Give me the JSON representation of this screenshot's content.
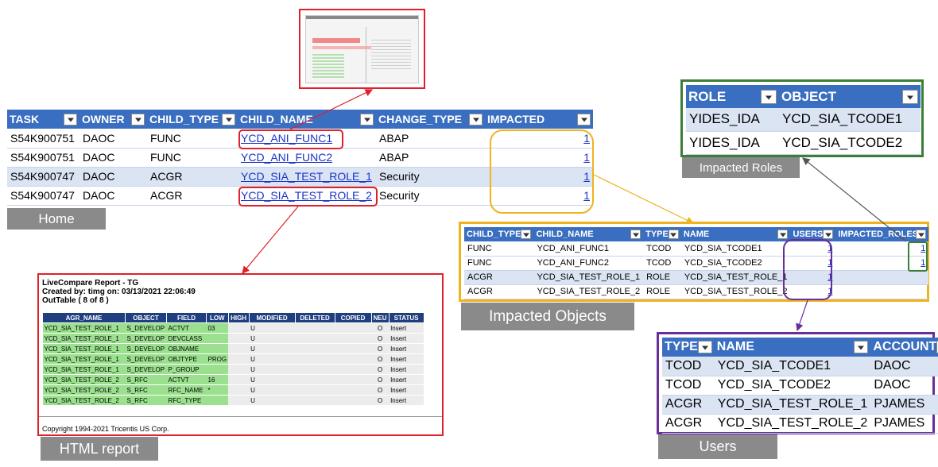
{
  "home": {
    "caption": "Home",
    "headers": [
      "TASK",
      "OWNER",
      "CHILD_TYPE",
      "CHILD_NAME",
      "CHANGE_TYPE",
      "IMPACTED"
    ],
    "rows": [
      {
        "task": "S54K900751",
        "owner": "DAOC",
        "child_type": "FUNC",
        "child_name": "YCD_ANI_FUNC1",
        "change_type": "ABAP",
        "impacted": "1"
      },
      {
        "task": "S54K900751",
        "owner": "DAOC",
        "child_type": "FUNC",
        "child_name": "YCD_ANI_FUNC2",
        "change_type": "ABAP",
        "impacted": "1"
      },
      {
        "task": "S54K900747",
        "owner": "DAOC",
        "child_type": "ACGR",
        "child_name": "YCD_SIA_TEST_ROLE_1",
        "change_type": "Security",
        "impacted": "1"
      },
      {
        "task": "S54K900747",
        "owner": "DAOC",
        "child_type": "ACGR",
        "child_name": "YCD_SIA_TEST_ROLE_2",
        "change_type": "Security",
        "impacted": "1"
      }
    ]
  },
  "impacted_roles": {
    "caption": "Impacted Roles",
    "headers": [
      "ROLE",
      "OBJECT"
    ],
    "rows": [
      {
        "role": "YIDES_IDA",
        "object": "YCD_SIA_TCODE1"
      },
      {
        "role": "YIDES_IDA",
        "object": "YCD_SIA_TCODE2"
      }
    ]
  },
  "impacted_objects": {
    "caption": "Impacted Objects",
    "headers": [
      "CHILD_TYPE",
      "CHILD_NAME",
      "TYPE",
      "NAME",
      "USERS",
      "IMPACTED_ROLES"
    ],
    "rows": [
      {
        "child_type": "FUNC",
        "child_name": "YCD_ANI_FUNC1",
        "type": "TCOD",
        "name": "YCD_SIA_TCODE1",
        "users": "1",
        "roles": "1"
      },
      {
        "child_type": "FUNC",
        "child_name": "YCD_ANI_FUNC2",
        "type": "TCOD",
        "name": "YCD_SIA_TCODE2",
        "users": "1",
        "roles": "1"
      },
      {
        "child_type": "ACGR",
        "child_name": "YCD_SIA_TEST_ROLE_1",
        "type": "ROLE",
        "name": "YCD_SIA_TEST_ROLE_1",
        "users": "1",
        "roles": ""
      },
      {
        "child_type": "ACGR",
        "child_name": "YCD_SIA_TEST_ROLE_2",
        "type": "ROLE",
        "name": "YCD_SIA_TEST_ROLE_2",
        "users": "1",
        "roles": ""
      }
    ]
  },
  "users": {
    "caption": "Users",
    "headers": [
      "TYPE",
      "NAME",
      "ACCOUNT"
    ],
    "rows": [
      {
        "type": "TCOD",
        "name": "YCD_SIA_TCODE1",
        "account": "DAOC"
      },
      {
        "type": "TCOD",
        "name": "YCD_SIA_TCODE2",
        "account": "DAOC"
      },
      {
        "type": "ACGR",
        "name": "YCD_SIA_TEST_ROLE_1",
        "account": "PJAMES"
      },
      {
        "type": "ACGR",
        "name": "YCD_SIA_TEST_ROLE_2",
        "account": "PJAMES"
      }
    ]
  },
  "html_report": {
    "caption": "HTML report",
    "title": "LiveCompare Report - TG",
    "created": "Created by: timg on: 03/13/2021 22:06:49",
    "outtable": "OutTable ( 8 of 8 )",
    "headers": [
      "AGR_NAME",
      "OBJECT",
      "FIELD",
      "LOW",
      "HIGH",
      "MODIFIED",
      "DELETED",
      "COPIED",
      "NEU",
      "STATUS"
    ],
    "rows": [
      [
        "YCD_SIA_TEST_ROLE_1",
        "S_DEVELOP",
        "ACTVT",
        "03",
        "",
        "U",
        "",
        "",
        "O",
        "Insert"
      ],
      [
        "YCD_SIA_TEST_ROLE_1",
        "S_DEVELOP",
        "DEVCLASS",
        "",
        "",
        "U",
        "",
        "",
        "O",
        "Insert"
      ],
      [
        "YCD_SIA_TEST_ROLE_1",
        "S_DEVELOP",
        "OBJNAME",
        "",
        "",
        "U",
        "",
        "",
        "O",
        "Insert"
      ],
      [
        "YCD_SIA_TEST_ROLE_1",
        "S_DEVELOP",
        "OBJTYPE",
        "PROG",
        "",
        "U",
        "",
        "",
        "O",
        "Insert"
      ],
      [
        "YCD_SIA_TEST_ROLE_1",
        "S_DEVELOP",
        "P_GROUP",
        "",
        "",
        "U",
        "",
        "",
        "O",
        "Insert"
      ],
      [
        "YCD_SIA_TEST_ROLE_2",
        "S_RFC",
        "ACTVT",
        "16",
        "",
        "U",
        "",
        "",
        "O",
        "Insert"
      ],
      [
        "YCD_SIA_TEST_ROLE_2",
        "S_RFC",
        "RFC_NAME",
        "*",
        "",
        "U",
        "",
        "",
        "O",
        "Insert"
      ],
      [
        "YCD_SIA_TEST_ROLE_2",
        "S_RFC",
        "RFC_TYPE",
        "",
        "",
        "U",
        "",
        "",
        "O",
        "Insert"
      ]
    ],
    "copyright": "Copyright 1994-2021 Tricentis US Corp."
  },
  "colors": {
    "header_blue": "#3a6ec0",
    "band": "#dbe4f3",
    "red": "#e0202a",
    "amber": "#f0b21e",
    "green": "#3a7f36",
    "purple": "#6a2e9a",
    "caption_gray": "#8a8a8a"
  }
}
